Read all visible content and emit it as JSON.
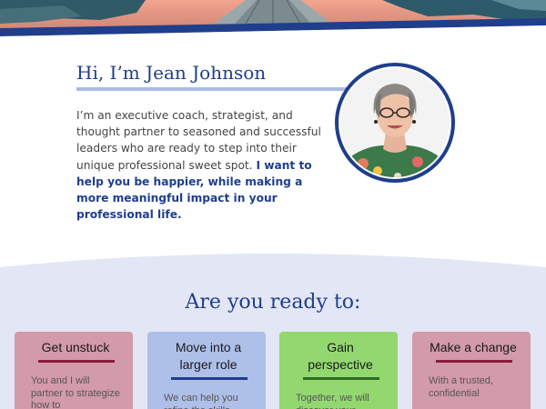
{
  "intro": {
    "title": "Hi, I’m Jean Johnson",
    "text_plain": "I’m an executive coach, strategist, and thought partner to seasoned and successful leaders who are ready to step into their unique professional sweet spot.",
    "text_highlight": "I want to help you be happier, while making a more meaningful impact in your professional life."
  },
  "section": {
    "heading": "Are you ready to:"
  },
  "cards": [
    {
      "title": "Get unstuck",
      "body": "You and I will partner to strategize how to",
      "color": "#d39aa9",
      "rule_color": "#8a1c3c"
    },
    {
      "title": "Move into a larger role",
      "body": "We can help you refine the skills",
      "color": "#aebfe8",
      "rule_color": "#1f3e8c"
    },
    {
      "title": "Gain perspective",
      "body": "Together, we will discover your",
      "color": "#93d76f",
      "rule_color": "#2f6d22"
    },
    {
      "title": "Make a change",
      "body": "With a trusted, confidential",
      "color": "#d39aa9",
      "rule_color": "#8a1c3c"
    }
  ],
  "colors": {
    "brand_blue": "#1f3e8c",
    "section_bg": "#e3e6f5"
  }
}
